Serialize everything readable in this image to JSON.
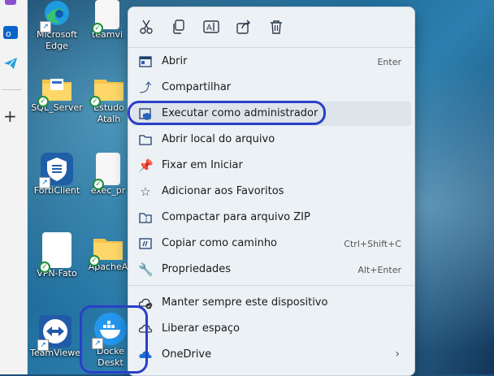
{
  "desktop": {
    "icons": [
      {
        "label": "Microsoft\nEdge"
      },
      {
        "label": "teamvi"
      },
      {
        "label": "SQL_Server"
      },
      {
        "label": "Estudo\nAtalh"
      },
      {
        "label": "FortiClient"
      },
      {
        "label": "exec_pr"
      },
      {
        "label": "VPN-Fato"
      },
      {
        "label": "ApacheA"
      },
      {
        "label": "TeamViewe"
      },
      {
        "label": "Docke\nDeskt"
      }
    ]
  },
  "context_menu": {
    "toolbar": [
      {
        "icon": "cut-icon"
      },
      {
        "icon": "copy-icon"
      },
      {
        "icon": "rename-icon"
      },
      {
        "icon": "share-icon"
      },
      {
        "icon": "delete-icon"
      }
    ],
    "items": [
      {
        "label": "Abrir",
        "shortcut": "Enter",
        "icon": "open-icon"
      },
      {
        "label": "Compartilhar",
        "shortcut": "",
        "icon": "share-icon"
      },
      {
        "label": "Executar como administrador",
        "shortcut": "",
        "icon": "shield-icon"
      },
      {
        "label": "Abrir local do arquivo",
        "shortcut": "",
        "icon": "folder-icon"
      },
      {
        "label": "Fixar em Iniciar",
        "shortcut": "",
        "icon": "pin-icon"
      },
      {
        "label": "Adicionar aos Favoritos",
        "shortcut": "",
        "icon": "star-icon"
      },
      {
        "label": "Compactar para arquivo ZIP",
        "shortcut": "",
        "icon": "zip-icon"
      },
      {
        "label": "Copiar como caminho",
        "shortcut": "Ctrl+Shift+C",
        "icon": "path-icon"
      },
      {
        "label": "Propriedades",
        "shortcut": "Alt+Enter",
        "icon": "wrench-icon"
      },
      {
        "label": "Manter sempre este dispositivo",
        "shortcut": "",
        "icon": "cloud-keep-icon"
      },
      {
        "label": "Liberar espaço",
        "shortcut": "",
        "icon": "cloud-free-icon"
      },
      {
        "label": "OneDrive",
        "shortcut": "",
        "icon": "onedrive-icon"
      }
    ],
    "highlighted": "Executar como administrador"
  },
  "colors": {
    "annotation": "#2a3fc8",
    "menu_bg": "#ecf1f5",
    "accent": "#2d4f7a"
  }
}
